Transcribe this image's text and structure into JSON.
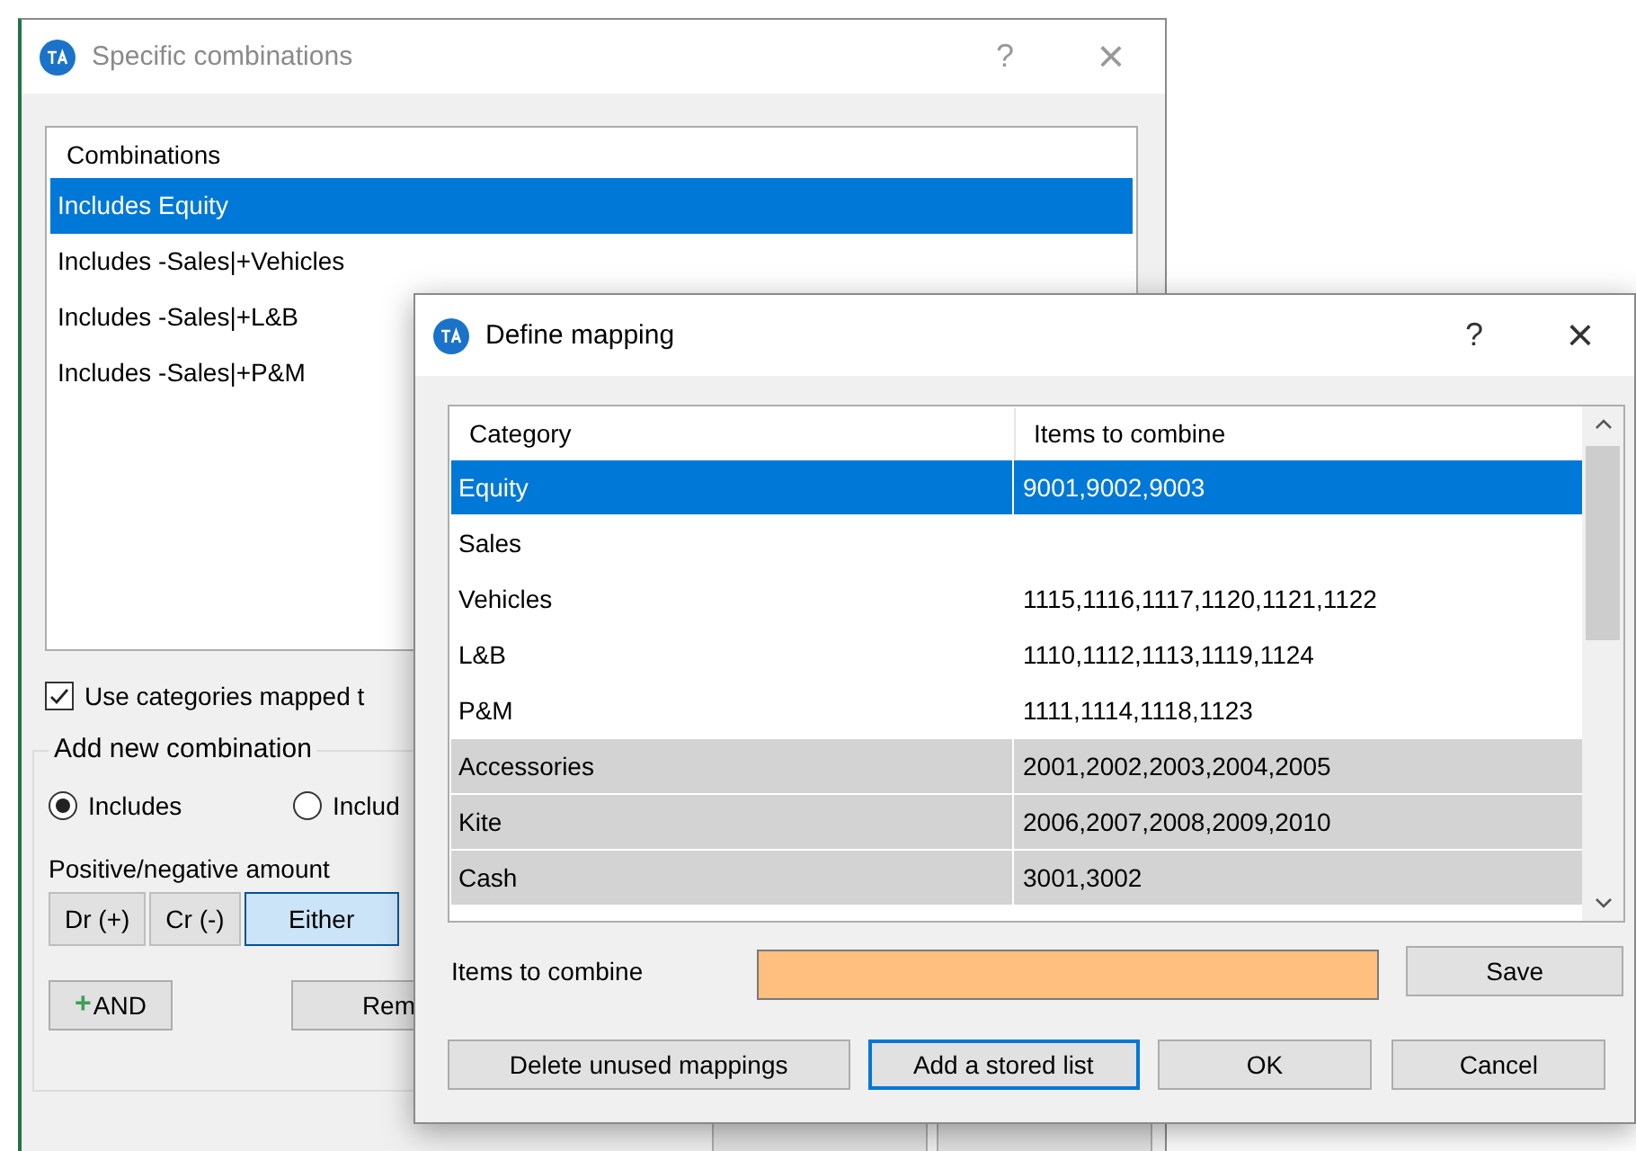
{
  "back_window": {
    "title": "Specific combinations",
    "help": "?",
    "close": "×",
    "list": {
      "header": "Combinations",
      "items": [
        {
          "label": "Includes Equity",
          "selected": true
        },
        {
          "label": "Includes -Sales|+Vehicles",
          "selected": false
        },
        {
          "label": "Includes -Sales|+L&B",
          "selected": false
        },
        {
          "label": "Includes -Sales|+P&M",
          "selected": false
        }
      ]
    },
    "use_categories": {
      "label": "Use categories mapped t",
      "checked": true
    },
    "group": {
      "title": "Add new combination",
      "radios": [
        {
          "label": "Includes",
          "selected": true
        },
        {
          "label": "Includ",
          "selected": false
        }
      ],
      "amount_label": "Positive/negative amount",
      "amount_options": [
        {
          "label": "Dr (+)",
          "selected": false
        },
        {
          "label": "Cr (-)",
          "selected": false
        },
        {
          "label": "Either",
          "selected": true
        }
      ],
      "and_button": {
        "icon": "+",
        "label": "AND"
      },
      "remove_button": "Rem"
    }
  },
  "dialog": {
    "title": "Define mapping",
    "help": "?",
    "close": "×",
    "table": {
      "columns": [
        "Category",
        "Items to combine"
      ],
      "rows": [
        {
          "category": "Equity",
          "items": "9001,9002,9003",
          "selected": true,
          "shaded": false
        },
        {
          "category": "Sales",
          "selected": false,
          "shaded": false
        },
        {
          "category": "Vehicles",
          "items": "1115,1116,1117,1120,1121,1122",
          "selected": false,
          "shaded": false
        },
        {
          "category": "L&B",
          "items": "1110,1112,1113,1119,1124",
          "selected": false,
          "shaded": false
        },
        {
          "category": "P&M",
          "items": "1111,1114,1118,1123",
          "selected": false,
          "shaded": false
        },
        {
          "category": "Accessories",
          "items": "2001,2002,2003,2004,2005",
          "selected": false,
          "shaded": true
        },
        {
          "category": "Kite",
          "items": "2006,2007,2008,2009,2010",
          "selected": false,
          "shaded": true
        },
        {
          "category": "Cash",
          "items": "3001,3002",
          "selected": false,
          "shaded": true
        }
      ]
    },
    "items_label": "Items to combine",
    "save": "Save",
    "buttons": [
      {
        "label": "Delete unused mappings",
        "focused": false
      },
      {
        "label": "Add a stored list",
        "focused": true
      },
      {
        "label": "OK",
        "focused": false
      },
      {
        "label": "Cancel",
        "focused": false
      }
    ]
  }
}
